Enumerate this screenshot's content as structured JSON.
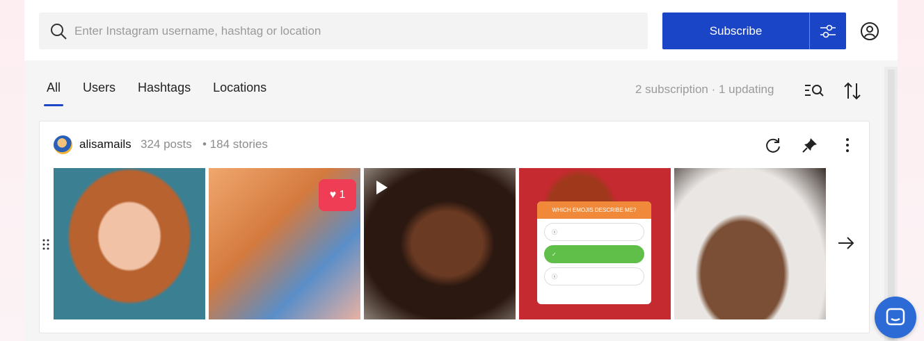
{
  "search": {
    "placeholder": "Enter Instagram username, hashtag or location"
  },
  "actions": {
    "subscribe_label": "Subscribe"
  },
  "tabs": [
    "All",
    "Users",
    "Hashtags",
    "Locations"
  ],
  "status_text": "2 subscription · 1 updating",
  "subscription": {
    "username": "alisamails",
    "posts": "324 posts",
    "stories": "• 184 stories",
    "like_count": "1",
    "poll": {
      "question": "WHICH EMOJIS DESCRIBE ME?"
    }
  },
  "colors": {
    "accent": "#1a45c6",
    "chat": "#2c6ad6"
  }
}
